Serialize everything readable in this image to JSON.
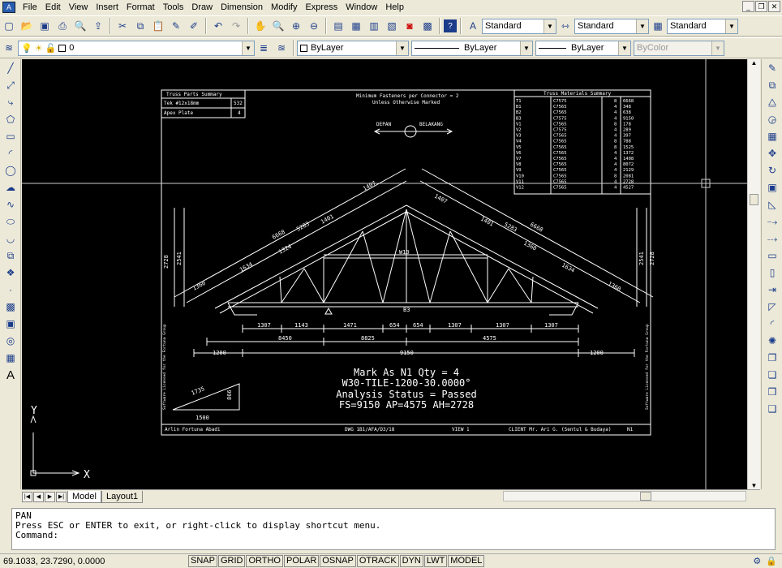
{
  "menu": {
    "items": [
      "File",
      "Edit",
      "View",
      "Insert",
      "Format",
      "Tools",
      "Draw",
      "Dimension",
      "Modify",
      "Express",
      "Window",
      "Help"
    ]
  },
  "toolbar": {
    "text_style": "Standard",
    "dim_style": "Standard",
    "table_style": "Standard",
    "layer": "0",
    "color": "ByLayer",
    "linetype": "ByLayer",
    "lineweight": "ByLayer",
    "plot_style": "ByColor"
  },
  "drawing": {
    "parts_summary_title": "Truss Parts Summary",
    "parts_rows": [
      {
        "name": "Tek #12x18mm",
        "qty": "532"
      },
      {
        "name": "Apex Plate",
        "qty": "4"
      }
    ],
    "fastener_note_1": "Minimum Fasteners per Connector = 2",
    "fastener_note_2": "Unless Otherwise Marked",
    "front_label": "DEPAN",
    "back_label": "BELAKANG",
    "materials_title": "Truss Materials Summary",
    "materials_rows": [
      [
        "T1",
        "C7575",
        "8",
        "6668"
      ],
      [
        "B1",
        "C7565",
        "4",
        "348"
      ],
      [
        "B2",
        "C7565",
        "4",
        "638"
      ],
      [
        "B3",
        "C7575",
        "4",
        "9150"
      ],
      [
        "V1",
        "C7565",
        "8",
        "178"
      ],
      [
        "V2",
        "C7575",
        "4",
        "289"
      ],
      [
        "V3",
        "C7565",
        "4",
        "397"
      ],
      [
        "V4",
        "C7565",
        "8",
        "788"
      ],
      [
        "V5",
        "C7565",
        "8",
        "1525"
      ],
      [
        "V6",
        "C7565",
        "4",
        "1372"
      ],
      [
        "V7",
        "C7565",
        "4",
        "1408"
      ],
      [
        "V8",
        "C7565",
        "4",
        "8072"
      ],
      [
        "V9",
        "C7565",
        "4",
        "2129"
      ],
      [
        "V10",
        "C7565",
        "8",
        "2081"
      ],
      [
        "V11",
        "C7565",
        "4",
        "2728"
      ],
      [
        "V12",
        "C7565",
        "4",
        "4527"
      ]
    ],
    "mark_line": "Mark As N1 Qty = 4",
    "spec_line": "W30-TILE-1200-30.0000°",
    "analysis_line": "Analysis Status = Passed",
    "dims_line": "FS=9150 AP=4575 AH=2728",
    "bottom_dims_1": [
      "1307",
      "1143",
      "1471",
      "654",
      "654",
      "1307",
      "1307",
      "1307"
    ],
    "bottom_dims_2": [
      "8450",
      "8825",
      "4575"
    ],
    "span": "9150",
    "overhang_left": "1200",
    "overhang_right": "1200",
    "top_left_labels": [
      "1407",
      "6668",
      "5283",
      "1401",
      "1324",
      "1634",
      "1360"
    ],
    "top_right_labels": [
      "1407",
      "1401",
      "5283",
      "6668",
      "1360",
      "1634",
      "1360"
    ],
    "height_left": [
      "2728",
      "2541"
    ],
    "height_right": [
      "2541",
      "2728"
    ],
    "web_label_center": "W10",
    "web_label_bottom": "B3",
    "triangle_dims": [
      "1500",
      "1735",
      "866"
    ],
    "side_text_left": "Software Licensed for the Fortuna Group",
    "side_text_right": "Software Licensed for the Fortuna Group",
    "title_block": [
      "Arlin Fortuna Abadi",
      "DWG  1B1/AFA/D3/18",
      "VIEW 1",
      "CLIENT  Mr. Ari G. (Sentul & Budaya)",
      "N1"
    ],
    "ucs_x": "X",
    "ucs_y": "Y"
  },
  "tabs": [
    "Model",
    "Layout1"
  ],
  "command": {
    "line1": "PAN",
    "line2": "Press ESC or ENTER to exit, or right-click to display shortcut menu.",
    "prompt": "Command:"
  },
  "status": {
    "coords": "69.1033, 23.7290, 0.0000",
    "toggles": [
      "SNAP",
      "GRID",
      "ORTHO",
      "POLAR",
      "OSNAP",
      "OTRACK",
      "DYN",
      "LWT",
      "MODEL"
    ]
  }
}
